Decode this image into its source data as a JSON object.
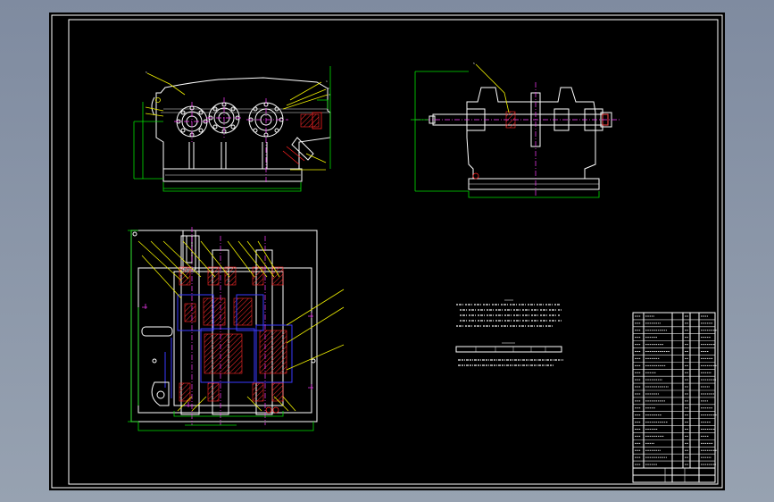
{
  "colors": {
    "background_frame": "#8a95a5",
    "sheet": "#000000",
    "outline": "#ffffff",
    "dimension": "#00e000",
    "leader": "#f0f000",
    "centerline": "#ff3cff",
    "section": "#ff2020",
    "hidden": "#3a3aff"
  },
  "views": [
    {
      "name": "front-view"
    },
    {
      "name": "side-view"
    },
    {
      "name": "top-section-view"
    }
  ],
  "title_block": {
    "rows": 22
  }
}
